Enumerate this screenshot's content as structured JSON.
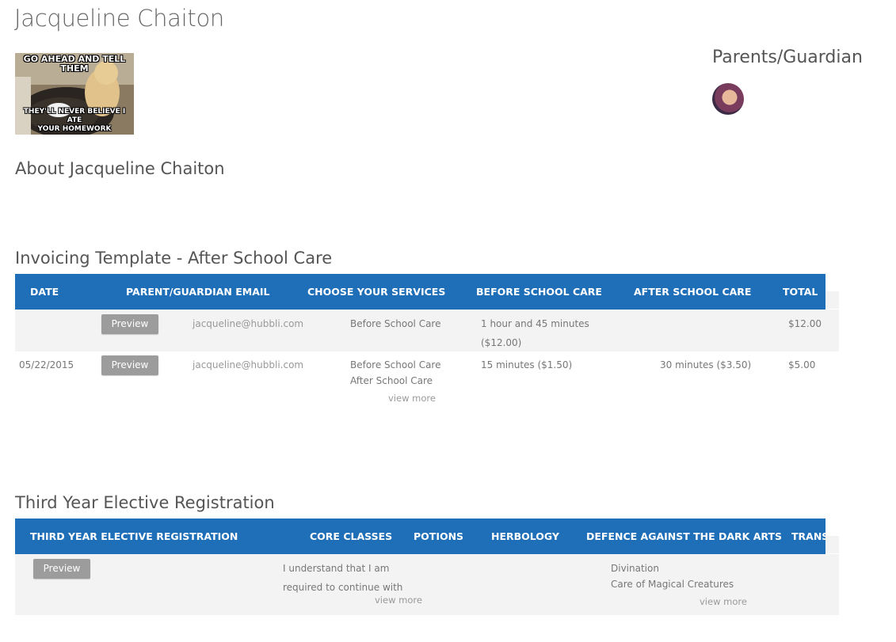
{
  "student": {
    "name": "Jacqueline Chaiton",
    "photo_top_text": "GO AHEAD AND TELL THEM",
    "photo_bottom_text_1": "THEY'LL NEVER BELIEVE I ATE",
    "photo_bottom_text_2": "YOUR HOMEWORK"
  },
  "guardian": {
    "title": "Parents/Guardian"
  },
  "about": {
    "title": "About Jacqueline Chaiton"
  },
  "invoicing": {
    "title": "Invoicing Template - After School Care",
    "headers": [
      "DATE",
      "PARENT/GUARDIAN EMAIL",
      "CHOOSE YOUR SERVICES",
      "BEFORE SCHOOL CARE",
      "AFTER SCHOOL CARE",
      "TOTAL"
    ],
    "rows": [
      {
        "date": "",
        "preview": "Preview",
        "email": "jacqueline@hubbli.com",
        "services_1": "Before School Care",
        "services_2": "",
        "before_1": "1 hour and 45 minutes",
        "before_2": "($12.00)",
        "after": "",
        "total": "$12.00"
      },
      {
        "date": "05/22/2015",
        "preview": "Preview",
        "email": "jacqueline@hubbli.com",
        "services_1": "Before School Care",
        "services_2": "After School Care",
        "view_more": "view more",
        "before_1": "15 minutes ($1.50)",
        "after": "30 minutes ($3.50)",
        "total": "$5.00"
      }
    ]
  },
  "elective": {
    "title": "Third Year Elective Registration",
    "headers": [
      "THIRD YEAR ELECTIVE REGISTRATION",
      "CORE CLASSES",
      "POTIONS",
      "HERBOLOGY",
      "DEFENCE AGAINST THE DARK ARTS",
      "TRANS"
    ],
    "row": {
      "preview": "Preview",
      "core_1": "I understand that I am",
      "core_2": "required to continue with",
      "core_view_more": "view more",
      "defence_1": "Divination",
      "defence_2": "Care of Magical Creatures",
      "defence_view_more": "view more"
    }
  }
}
